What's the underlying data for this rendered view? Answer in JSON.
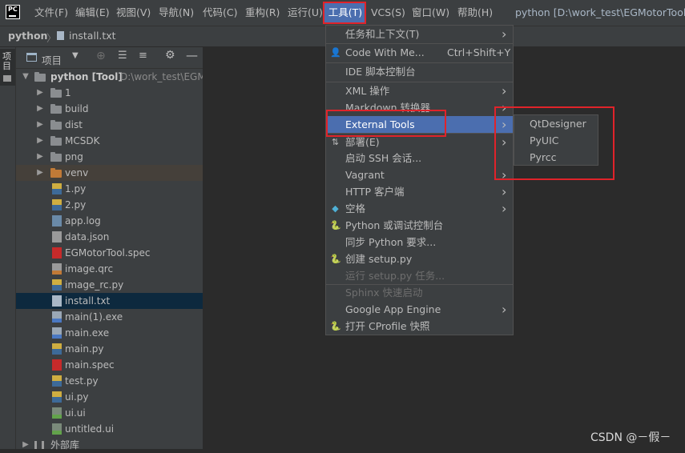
{
  "menubar": {
    "logo_text": "PC",
    "items": [
      "文件(F)",
      "编辑(E)",
      "视图(V)",
      "导航(N)",
      "代码(C)",
      "重构(R)",
      "运行(U)",
      "工具(T)",
      "VCS(S)",
      "窗口(W)",
      "帮助(H)"
    ],
    "active": "工具(T)",
    "window_title": "python [D:\\work_test\\EGMotorTool\\p"
  },
  "navbar": {
    "project": "python",
    "file": "install.txt"
  },
  "side_strip": {
    "project_tab_label": "项目"
  },
  "project_panel": {
    "title": "项目",
    "root": {
      "name": "python [Tool]",
      "path": "D:\\work_test\\EGM"
    },
    "items": [
      {
        "name": "1",
        "kind": "folder"
      },
      {
        "name": "build",
        "kind": "folder"
      },
      {
        "name": "dist",
        "kind": "folder"
      },
      {
        "name": "MCSDK",
        "kind": "folder"
      },
      {
        "name": "png",
        "kind": "folder"
      },
      {
        "name": "venv",
        "kind": "folder-excluded"
      },
      {
        "name": "1.py",
        "kind": "py"
      },
      {
        "name": "2.py",
        "kind": "py"
      },
      {
        "name": "app.log",
        "kind": "log"
      },
      {
        "name": "data.json",
        "kind": "json"
      },
      {
        "name": "EGMotorTool.spec",
        "kind": "spec"
      },
      {
        "name": "image.qrc",
        "kind": "qrc"
      },
      {
        "name": "image_rc.py",
        "kind": "py"
      },
      {
        "name": "install.txt",
        "kind": "txt",
        "selected": true
      },
      {
        "name": "main(1).exe",
        "kind": "exe"
      },
      {
        "name": "main.exe",
        "kind": "exe"
      },
      {
        "name": "main.py",
        "kind": "py"
      },
      {
        "name": "main.spec",
        "kind": "spec"
      },
      {
        "name": "test.py",
        "kind": "py"
      },
      {
        "name": "ui.py",
        "kind": "py"
      },
      {
        "name": "ui.ui",
        "kind": "ui"
      },
      {
        "name": "untitled.ui",
        "kind": "ui"
      }
    ],
    "external_libs": "外部库"
  },
  "tools_menu": {
    "items": [
      {
        "label": "任务和上下文(T)",
        "submenu": true
      },
      {
        "label": "Code With Me...",
        "shortcut": "Ctrl+Shift+Y",
        "icon": "user-icon"
      },
      {
        "label": "IDE 脚本控制台"
      },
      {
        "label": "XML 操作",
        "submenu": true
      },
      {
        "label": "Markdown 转换器",
        "submenu": true
      },
      {
        "label": "External Tools",
        "submenu": true,
        "highlighted": true
      },
      {
        "label": "部署(E)",
        "submenu": true,
        "icon": "deploy-icon"
      },
      {
        "label": "启动 SSH 会话..."
      },
      {
        "label": "Vagrant",
        "submenu": true
      },
      {
        "label": "HTTP 客户端",
        "submenu": true
      },
      {
        "label": "空格",
        "submenu": true,
        "icon": "space-icon"
      },
      {
        "label": "Python 或调试控制台",
        "icon": "python-icon"
      },
      {
        "label": "同步 Python 要求..."
      },
      {
        "label": "创建 setup.py",
        "icon": "python-icon"
      },
      {
        "label": "运行 setup.py 任务...",
        "disabled": true
      },
      {
        "label": "Sphinx 快速启动",
        "disabled": true
      },
      {
        "label": "Google App Engine",
        "submenu": true
      },
      {
        "label": "打开 CProfile 快照",
        "icon": "python-icon"
      }
    ]
  },
  "external_tools_submenu": {
    "items": [
      "QtDesigner",
      "PyUIC",
      "Pyrcc"
    ]
  },
  "watermark": "CSDN @－假－",
  "colors": {
    "highlight": "#4b6eaf",
    "annotation": "#e0232a",
    "selection": "#0d293e"
  }
}
